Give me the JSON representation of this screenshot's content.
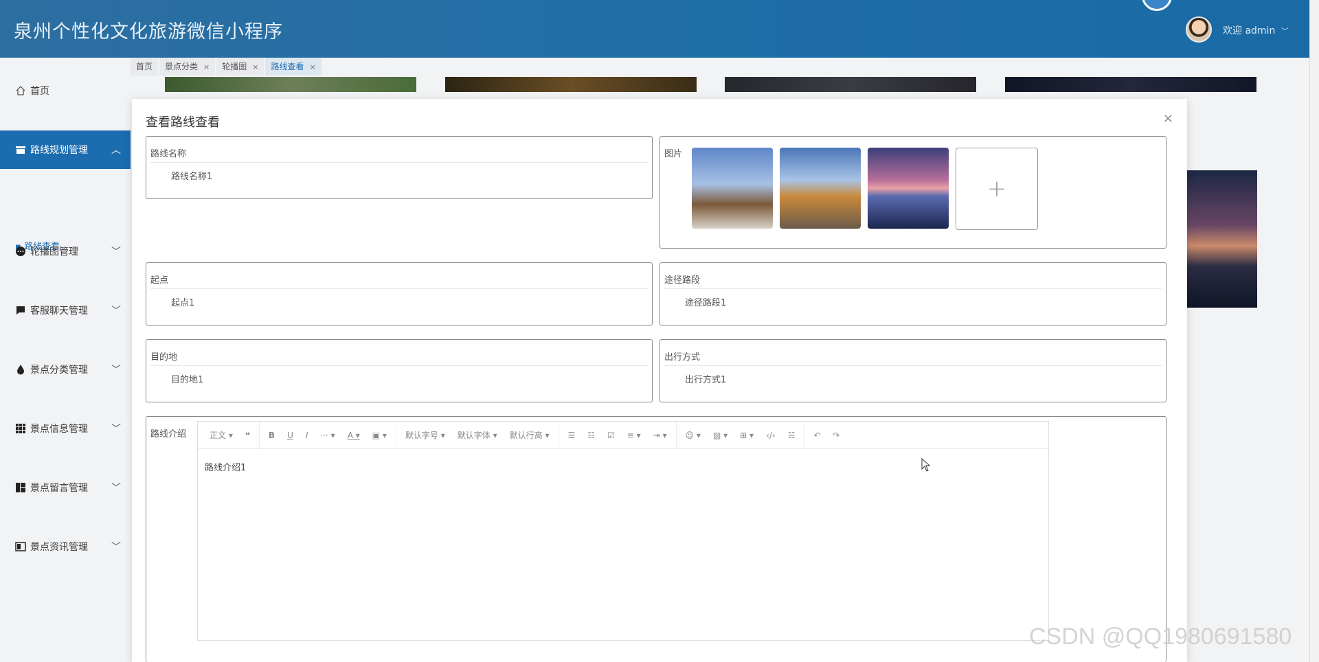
{
  "app": {
    "title": "泉州个性化文化旅游微信小程序",
    "welcome": "欢迎 admin"
  },
  "sidebar": {
    "items": [
      {
        "label": "首页",
        "icon": "home-icon"
      },
      {
        "label": "路线规划管理",
        "icon": "box-icon"
      },
      {
        "label": "轮播图管理",
        "icon": "more-icon"
      },
      {
        "label": "客服聊天管理",
        "icon": "chat-icon"
      },
      {
        "label": "景点分类管理",
        "icon": "drop-icon"
      },
      {
        "label": "景点信息管理",
        "icon": "grid-icon"
      },
      {
        "label": "景点留言管理",
        "icon": "board-icon"
      },
      {
        "label": "景点资讯管理",
        "icon": "news-icon"
      }
    ],
    "sub_item": "路线查看"
  },
  "tabs": [
    {
      "label": "首页",
      "closable": false
    },
    {
      "label": "景点分类",
      "closable": true
    },
    {
      "label": "轮播图",
      "closable": true
    },
    {
      "label": "路线查看",
      "closable": true
    }
  ],
  "dialog": {
    "title": "查看路线查看",
    "close": "×",
    "fields": {
      "name": {
        "label": "路线名称",
        "value": "路线名称1"
      },
      "images": {
        "label": "图片",
        "add": "+"
      },
      "start": {
        "label": "起点",
        "value": "起点1"
      },
      "route": {
        "label": "途径路段",
        "value": "途径路段1"
      },
      "dest": {
        "label": "目的地",
        "value": "目的地1"
      },
      "mode": {
        "label": "出行方式",
        "value": "出行方式1"
      },
      "intro": {
        "label": "路线介绍",
        "value": "路线介绍1"
      }
    },
    "toolbar": {
      "paragraph": "正文",
      "fontsize": "默认字号",
      "fontfamily": "默认字体",
      "lineheight": "默认行高"
    }
  },
  "watermark": "CSDN @QQ1980691580"
}
